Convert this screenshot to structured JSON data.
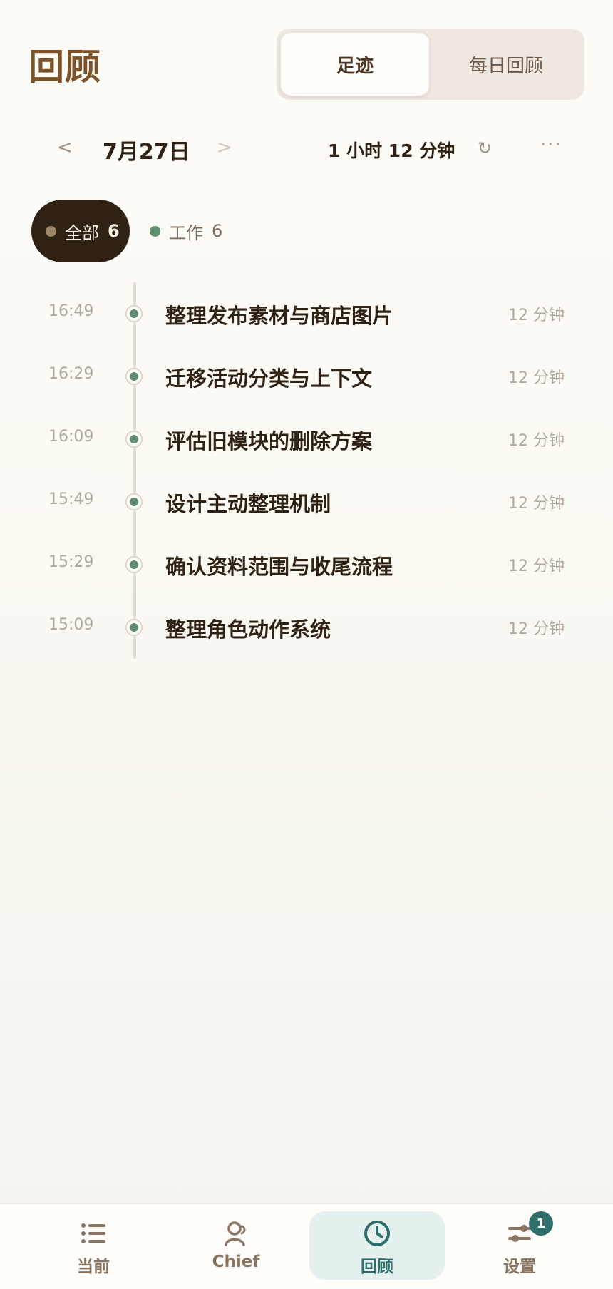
{
  "header": {
    "title": "回顾",
    "segments": [
      {
        "label": "足迹",
        "active": true
      },
      {
        "label": "每日回顾",
        "active": false
      }
    ]
  },
  "date_bar": {
    "prev": "<",
    "date": "7月27日",
    "next": ">",
    "total_duration": "1 小时 12 分钟",
    "refresh_icon": "refresh-icon",
    "more_icon": "more-icon"
  },
  "filters": [
    {
      "label": "全部",
      "count": "6",
      "selected": true,
      "dot_color": "#9d8667"
    },
    {
      "label": "工作",
      "count": "6",
      "selected": false,
      "dot_color": "#5f8f6e"
    }
  ],
  "activities": [
    {
      "time": "16:49",
      "title": "整理发布素材与商店图片",
      "duration": "12 分钟"
    },
    {
      "time": "16:29",
      "title": "迁移活动分类与上下文",
      "duration": "12 分钟"
    },
    {
      "time": "16:09",
      "title": "评估旧模块的删除方案",
      "duration": "12 分钟"
    },
    {
      "time": "15:49",
      "title": "设计主动整理机制",
      "duration": "12 分钟"
    },
    {
      "time": "15:29",
      "title": "确认资料范围与收尾流程",
      "duration": "12 分钟"
    },
    {
      "time": "15:09",
      "title": "整理角色动作系统",
      "duration": "12 分钟"
    }
  ],
  "bottom_nav": [
    {
      "label": "当前",
      "icon": "list-icon",
      "active": false
    },
    {
      "label": "Chief",
      "icon": "person-icon",
      "active": false
    },
    {
      "label": "回顾",
      "icon": "clock-icon",
      "active": true
    },
    {
      "label": "设置",
      "icon": "sliders-icon",
      "active": false,
      "badge": "1"
    }
  ],
  "colors": {
    "brand_brown": "#7b522a",
    "dark": "#2f2114",
    "accent_teal": "#2f6f6b",
    "work_green": "#5f8f6e"
  }
}
